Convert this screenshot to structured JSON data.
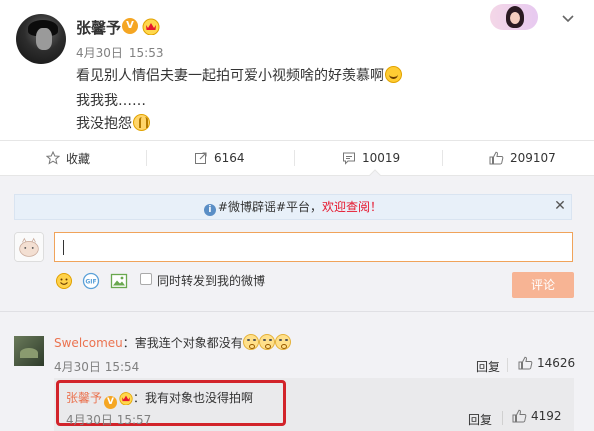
{
  "post": {
    "author": "张馨予",
    "verified_badge": "V",
    "date": "4月30日",
    "time": "15:53",
    "lines": [
      "看见别人情侣夫妻一起拍可爱小视频啥的好羡慕啊",
      "我我我……",
      "我没抱怨"
    ]
  },
  "actions": {
    "favorite_label": "收藏",
    "forward_count": "6164",
    "comment_count": "10019",
    "like_count": "209107"
  },
  "notice": {
    "prefix": "#微博辟谣#平台，",
    "highlight": "欢迎查阅！"
  },
  "composer": {
    "forward_option": "同时转发到我的微博",
    "submit_label": "评论"
  },
  "comments": [
    {
      "user": "Swelcomeu",
      "text": "：害我连个对象都没有",
      "date": "4月30日",
      "time": "15:54",
      "reply_label": "回复",
      "likes": "14626"
    }
  ],
  "reply": {
    "user": "张馨予",
    "verified_badge": "V",
    "text": "：我有对象也没得拍啊",
    "date": "4月30日",
    "time": "15:57",
    "reply_label": "回复",
    "likes": "4192"
  },
  "colors": {
    "accent_orange": "#eb7350",
    "submit_disabled": "#f7b494",
    "highlight_box": "#d2232a",
    "warning_red": "#e6162d",
    "verified_gold": "#f5a623"
  },
  "icons": [
    "star-icon",
    "forward-icon",
    "comment-icon",
    "thumbs-up-icon",
    "chevron-down-icon",
    "close-icon",
    "emoji-icon",
    "gif-icon",
    "image-icon",
    "info-icon",
    "crown-icon"
  ]
}
